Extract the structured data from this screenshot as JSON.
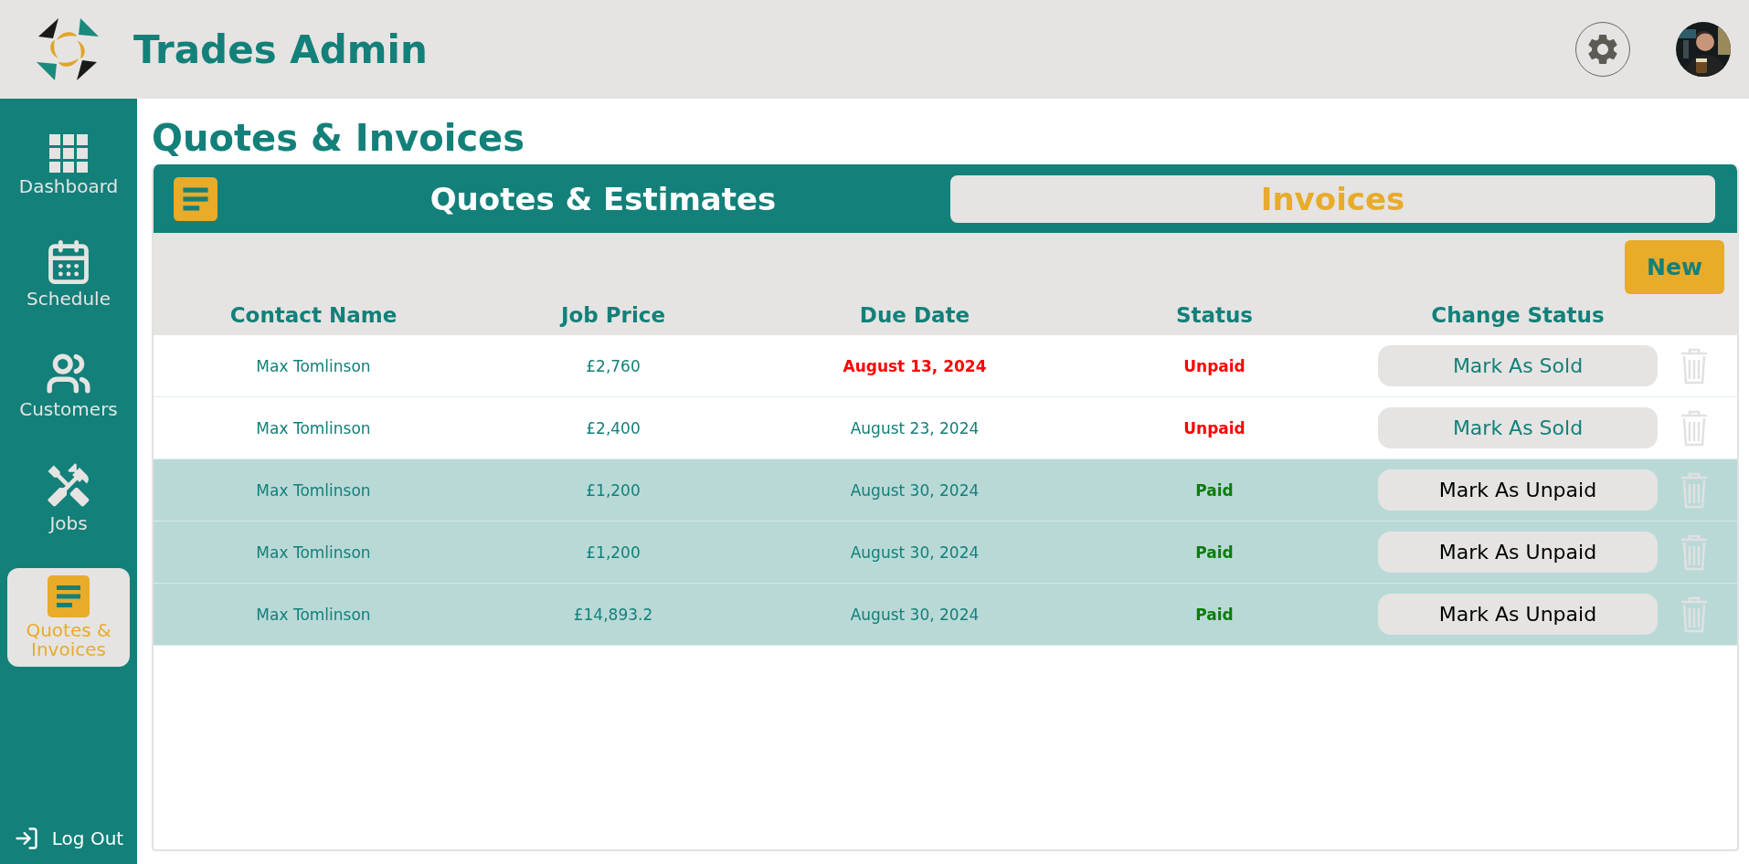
{
  "app": {
    "title": "Trades Admin"
  },
  "sidebar": {
    "items": [
      {
        "label": "Dashboard",
        "kind": "grid",
        "selected": false
      },
      {
        "label": "Schedule",
        "kind": "calendar",
        "selected": false
      },
      {
        "label": "Customers",
        "kind": "people",
        "selected": false
      },
      {
        "label": "Jobs",
        "kind": "tools",
        "selected": false
      },
      {
        "label": "Quotes & Invoices",
        "kind": "document",
        "selected": true
      }
    ],
    "logout": "Log Out"
  },
  "page": {
    "title": "Quotes & Invoices"
  },
  "tabs": [
    {
      "label": "Quotes & Estimates",
      "selected": false
    },
    {
      "label": "Invoices",
      "selected": true
    }
  ],
  "new_button": "New",
  "table": {
    "columns": [
      "Contact Name",
      "Job Price",
      "Due Date",
      "Status",
      "Change Status"
    ],
    "rows": [
      {
        "contact": "Max Tomlinson",
        "price": "£2,760",
        "due": "August 13, 2024",
        "overdue": true,
        "status": "Unpaid",
        "paid": false,
        "action": "Mark As Sold"
      },
      {
        "contact": "Max Tomlinson",
        "price": "£2,400",
        "due": "August 23, 2024",
        "overdue": false,
        "status": "Unpaid",
        "paid": false,
        "action": "Mark As Sold"
      },
      {
        "contact": "Max Tomlinson",
        "price": "£1,200",
        "due": "August 30, 2024",
        "overdue": false,
        "status": "Paid",
        "paid": true,
        "action": "Mark As Unpaid"
      },
      {
        "contact": "Max Tomlinson",
        "price": "£1,200",
        "due": "August 30, 2024",
        "overdue": false,
        "status": "Paid",
        "paid": true,
        "action": "Mark As Unpaid"
      },
      {
        "contact": "Max Tomlinson",
        "price": "£14,893.2",
        "due": "August 30, 2024",
        "overdue": false,
        "status": "Paid",
        "paid": true,
        "action": "Mark As Unpaid"
      }
    ]
  }
}
